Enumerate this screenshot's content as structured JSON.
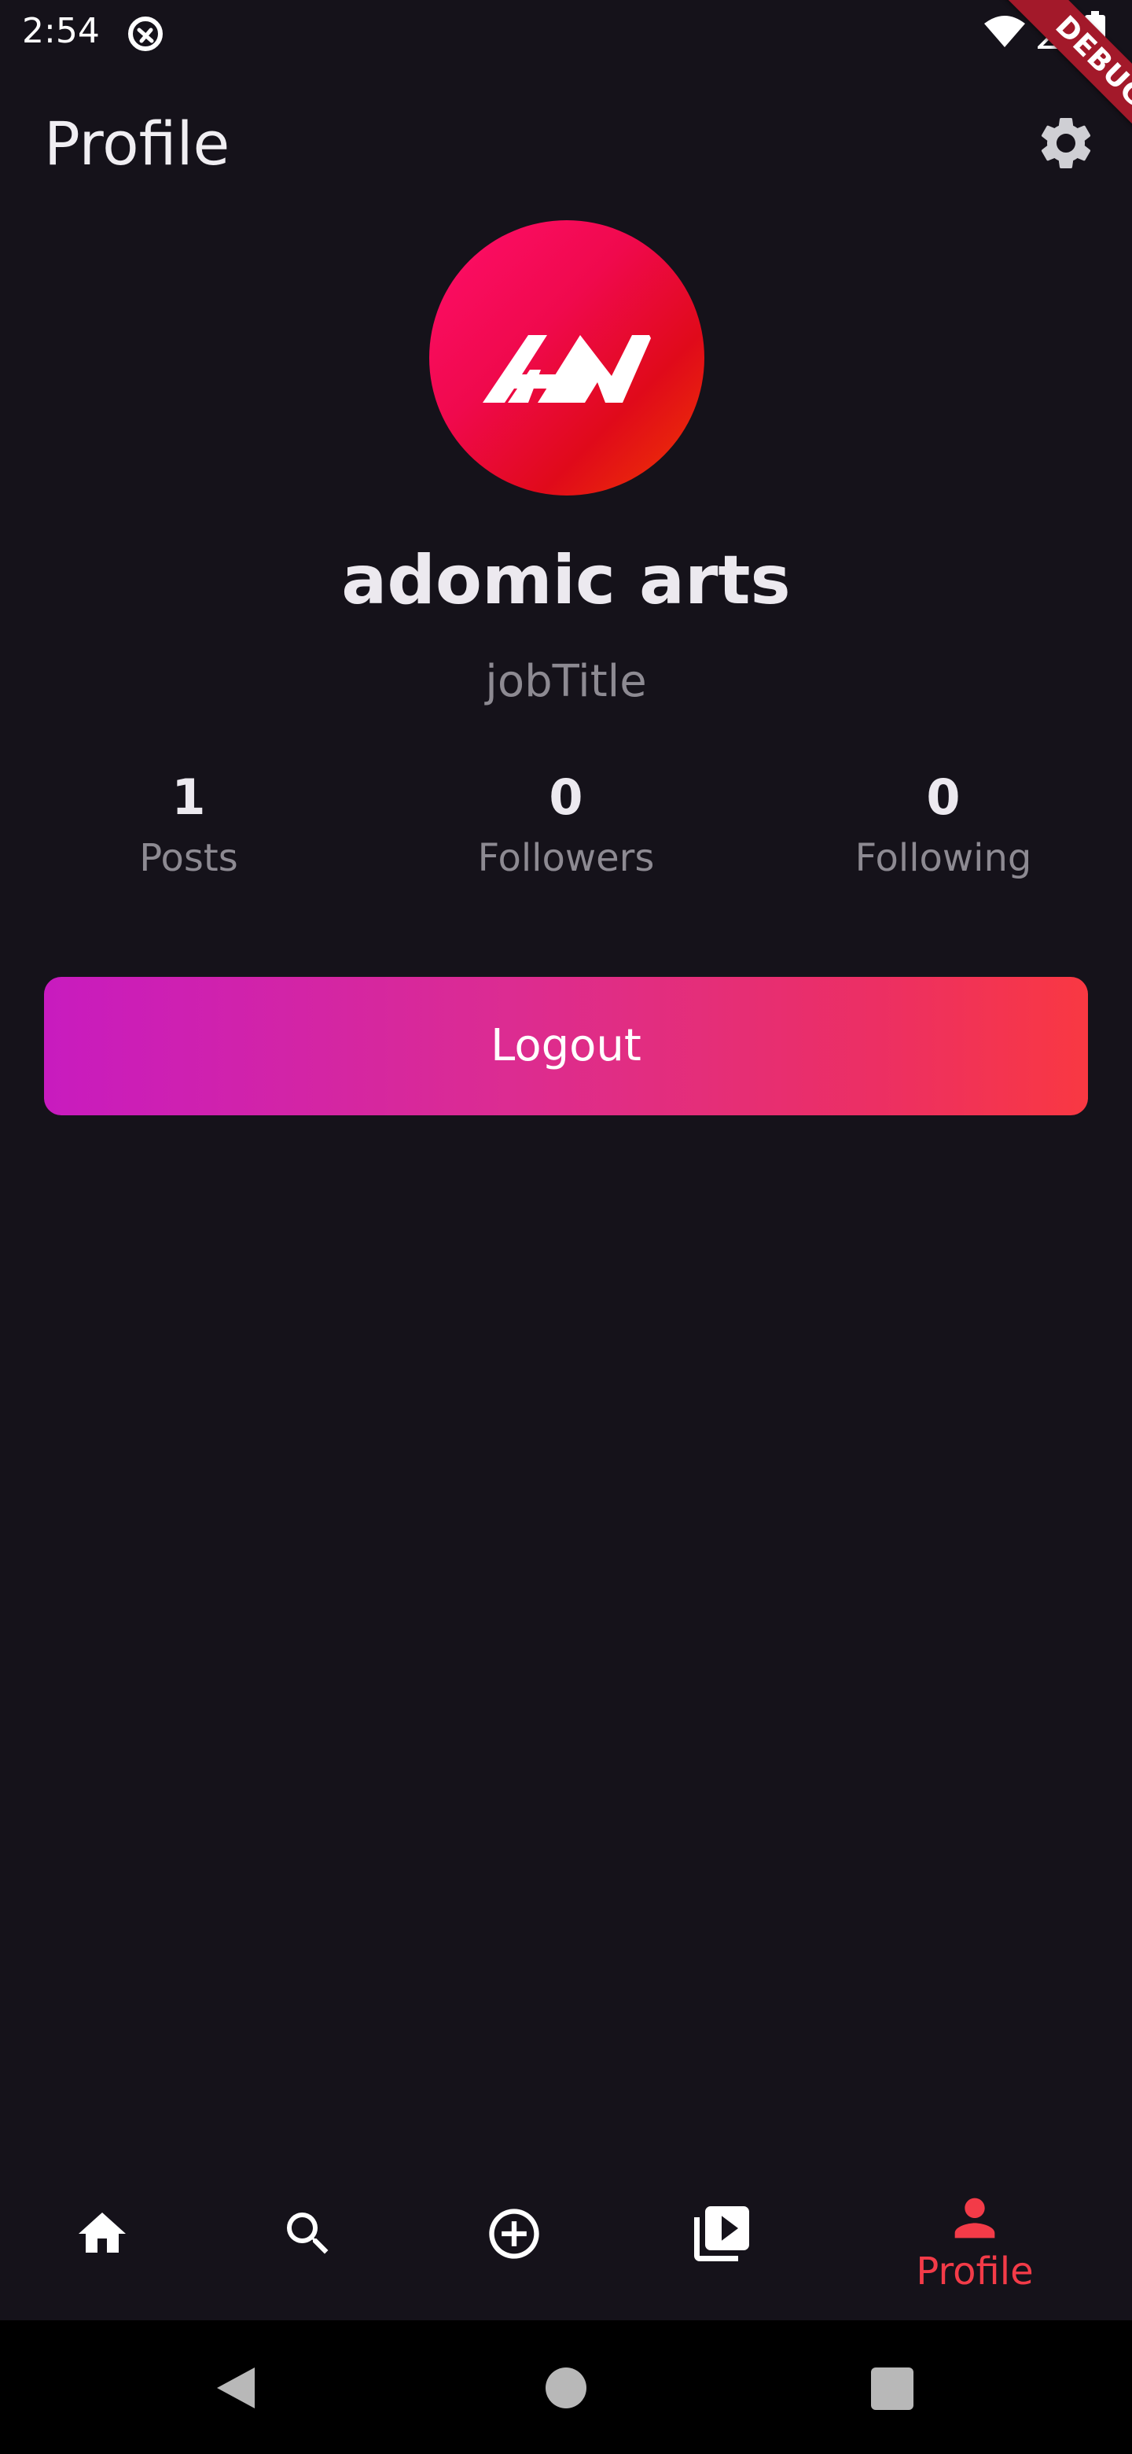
{
  "status_bar": {
    "time": "2:54",
    "icons": [
      "app-notification-icon",
      "wifi-icon",
      "signal-icon",
      "battery-icon"
    ]
  },
  "debug_banner": "DEBUG",
  "header": {
    "title": "Profile",
    "settings_icon": "gear-icon"
  },
  "profile": {
    "avatar_logo": "AA",
    "name": "adomic arts",
    "job_title": "jobTitle"
  },
  "stats": [
    {
      "value": "1",
      "label": "Posts"
    },
    {
      "value": "0",
      "label": "Followers"
    },
    {
      "value": "0",
      "label": "Following"
    }
  ],
  "actions": {
    "logout_label": "Logout"
  },
  "bottom_nav": {
    "items": [
      {
        "icon": "home-icon",
        "label": ""
      },
      {
        "icon": "search-icon",
        "label": ""
      },
      {
        "icon": "add-circle-icon",
        "label": ""
      },
      {
        "icon": "video-library-icon",
        "label": ""
      },
      {
        "icon": "person-icon",
        "label": "Profile",
        "active": true
      }
    ]
  },
  "system_nav": [
    "back-icon",
    "home-icon",
    "recents-icon"
  ],
  "colors": {
    "background": "#15121a",
    "accent": "#f33b48",
    "gradient_start": "#c81bbf",
    "gradient_end": "#f93842",
    "avatar": "#f0094d"
  }
}
